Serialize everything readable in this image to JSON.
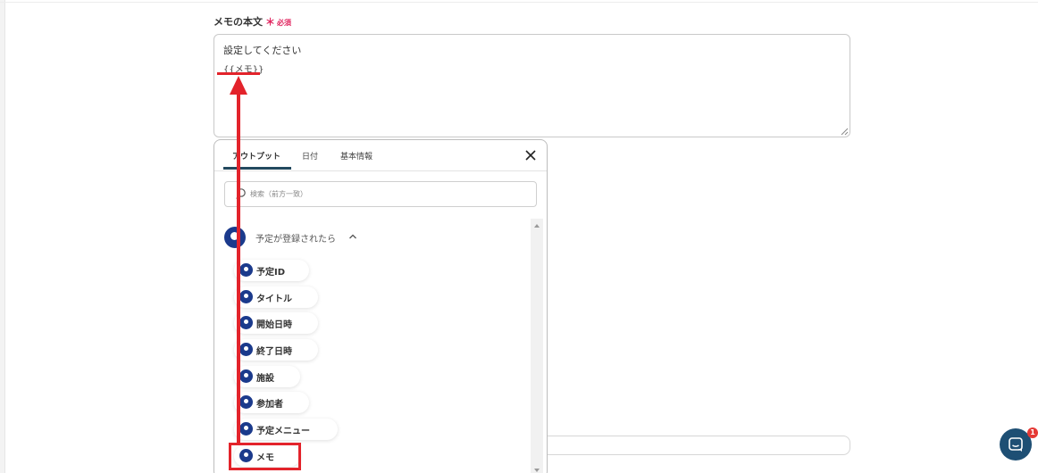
{
  "field": {
    "label": "メモの本文",
    "required_mark": "＊",
    "required_text": "必須"
  },
  "textarea": {
    "line1": "設定してください",
    "line2": "{{メモ}}"
  },
  "popup": {
    "tabs": [
      {
        "label": "アウトプット"
      },
      {
        "label": "日付"
      },
      {
        "label": "基本情報"
      }
    ],
    "search_placeholder": "検索（前方一致）",
    "group": {
      "label": "予定が登録されたら"
    },
    "items": [
      {
        "label": "予定ID"
      },
      {
        "label": "タイトル"
      },
      {
        "label": "開始日時"
      },
      {
        "label": "終了日時"
      },
      {
        "label": "施設"
      },
      {
        "label": "参加者"
      },
      {
        "label": "予定メニュー"
      },
      {
        "label": "メモ"
      }
    ]
  },
  "chat": {
    "badge_count": "1"
  },
  "colors": {
    "accent": "#23495f",
    "brand_logo": "#1b3a8c",
    "annotation": "#e3232b",
    "required": "#e0245e",
    "chat_button": "#1e4f74"
  }
}
